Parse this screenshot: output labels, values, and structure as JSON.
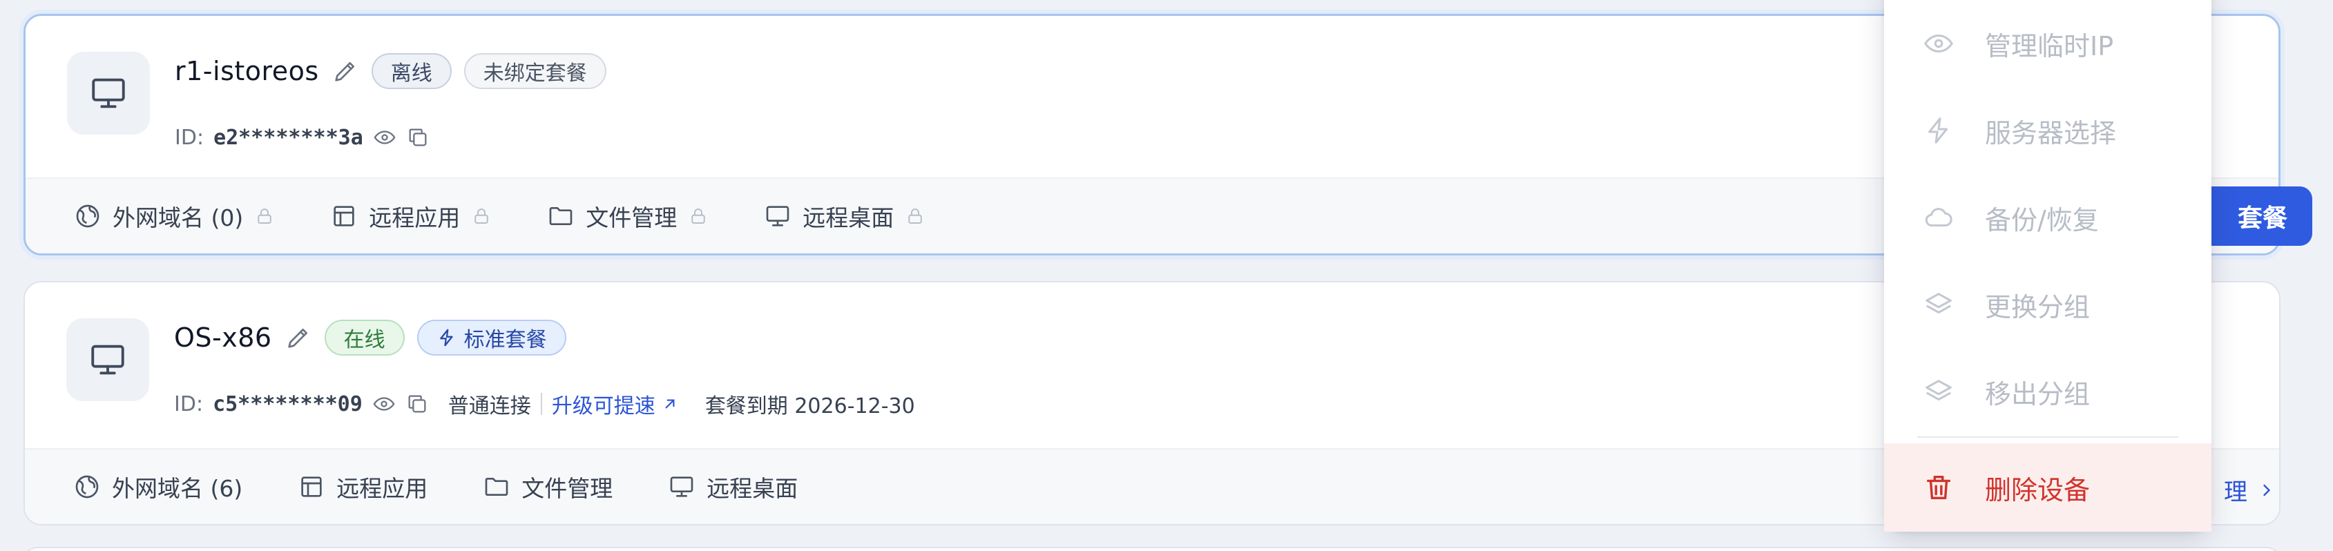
{
  "devices": [
    {
      "name": "r1-istoreos",
      "status_badge": "离线",
      "plan_badge": "未绑定套餐",
      "id_label": "ID:",
      "id_value": "e2********3a",
      "actions": [
        {
          "label": "外网域名 (0)",
          "locked": true
        },
        {
          "label": "远程应用",
          "locked": true
        },
        {
          "label": "文件管理",
          "locked": true
        },
        {
          "label": "远程桌面",
          "locked": true
        }
      ],
      "primary_button": "套餐"
    },
    {
      "name": "OS-x86",
      "status_badge": "在线",
      "plan_badge": "标准套餐",
      "id_label": "ID:",
      "id_value": "c5********09",
      "connection": "普通连接",
      "upgrade_link": "升级可提速",
      "expire": "套餐到期 2026-12-30",
      "actions": [
        {
          "label": "外网域名 (6)",
          "locked": false
        },
        {
          "label": "远程应用",
          "locked": false
        },
        {
          "label": "文件管理",
          "locked": false
        },
        {
          "label": "远程桌面",
          "locked": false
        }
      ],
      "manage_link": "理"
    }
  ],
  "menu": {
    "items": [
      {
        "label": "管理临时IP",
        "icon": "eye-icon"
      },
      {
        "label": "服务器选择",
        "icon": "lightning-icon"
      },
      {
        "label": "备份/恢复",
        "icon": "cloud-icon"
      },
      {
        "label": "更换分组",
        "icon": "layers-icon"
      },
      {
        "label": "移出分组",
        "icon": "layers-icon"
      }
    ],
    "danger": {
      "label": "删除设备",
      "icon": "trash-icon"
    }
  },
  "colors": {
    "accent": "#2f5be0",
    "danger": "#d0342c",
    "online": "#2e7d3a"
  }
}
